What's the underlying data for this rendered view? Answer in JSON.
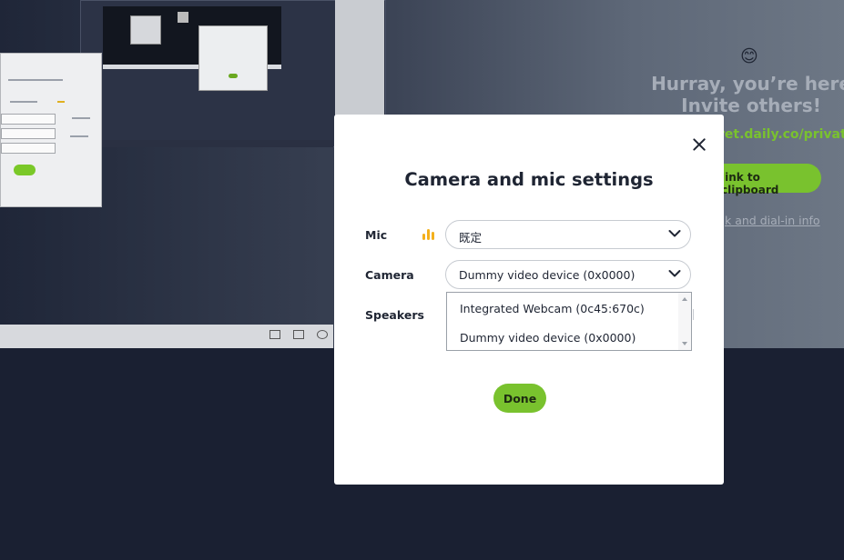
{
  "invite_panel": {
    "emoji": "😊",
    "title_line1": "Hurray, you’re here",
    "title_line2": "Invite others!",
    "link_text": "ret.daily.co/private",
    "copy_button_label": "link to clipboard",
    "dialin_link": "k and dial-in info"
  },
  "modal": {
    "title": "Camera and mic settings",
    "mic_label": "Mic",
    "mic_value": "既定",
    "camera_label": "Camera",
    "camera_value": "Dummy video device (0x0000)",
    "speakers_label": "Speakers",
    "camera_options": [
      "Integrated Webcam (0c45:670c)",
      "Dummy video device (0x0000)"
    ],
    "done_label": "Done"
  },
  "colors": {
    "accent": "#79c22e",
    "mic_level": "#f4b01c",
    "modal_bg": "#ffffff",
    "backdrop": "#1b2235"
  },
  "icons": {
    "close": "close-icon",
    "mic_level": "mic-level-icon",
    "chevron": "chevron-down-icon"
  }
}
